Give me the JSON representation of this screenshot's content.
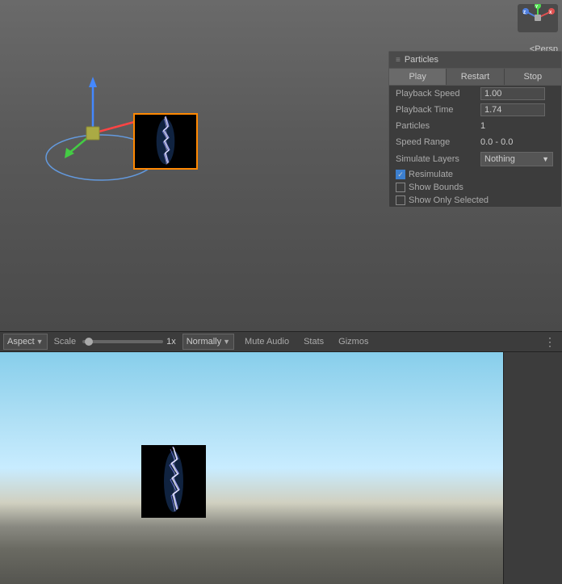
{
  "scene": {
    "persp_label": "<Persp",
    "background_color": "#5a5a5a"
  },
  "particles_panel": {
    "title": "Particles",
    "play_btn": "Play",
    "restart_btn": "Restart",
    "stop_btn": "Stop",
    "playback_speed_label": "Playback Speed",
    "playback_speed_value": "1.00",
    "playback_time_label": "Playback Time",
    "playback_time_value": "1.74",
    "particles_label": "Particles",
    "particles_value": "1",
    "speed_range_label": "Speed Range",
    "speed_range_value": "0.0 - 0.0",
    "simulate_layers_label": "Simulate Layers",
    "simulate_layers_value": "Nothing",
    "resimulate_label": "Resimulate",
    "resimulate_checked": true,
    "show_bounds_label": "Show Bounds",
    "show_bounds_checked": false,
    "show_only_selected_label": "Show Only Selected",
    "show_only_selected_checked": false
  },
  "toolbar": {
    "aspect_label": "Aspect",
    "scale_label": "Scale",
    "scale_value": "1x",
    "normally_label": "Normally",
    "mute_audio_label": "Mute Audio",
    "stats_label": "Stats",
    "gizmos_label": "Gizmos"
  }
}
